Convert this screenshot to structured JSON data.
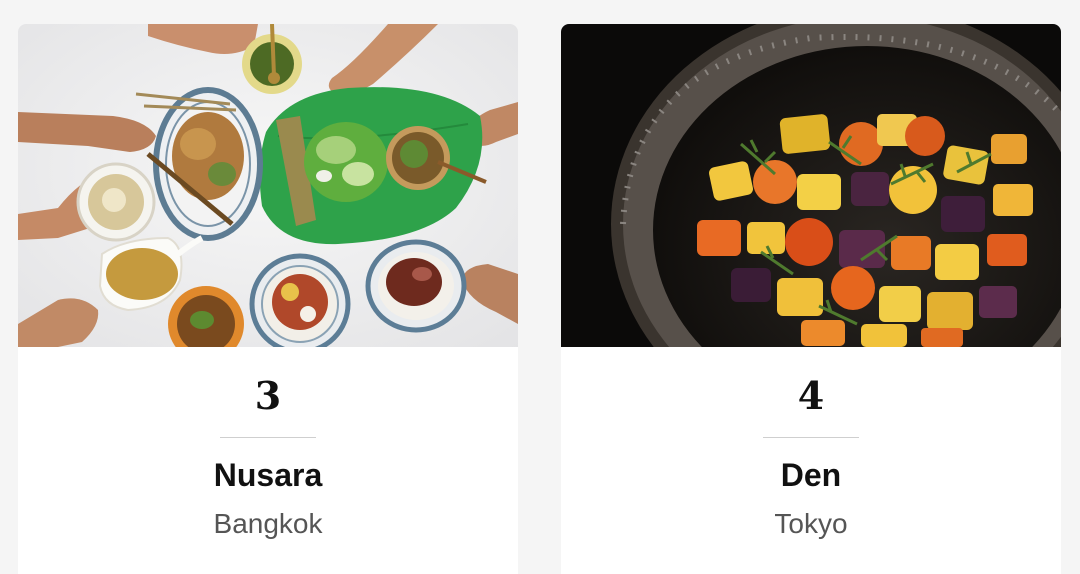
{
  "cards": [
    {
      "rank": "3",
      "name": "Nusara",
      "city": "Bangkok",
      "image_alt": "Overhead view of Thai dishes on a white table with hands reaching in"
    },
    {
      "rank": "4",
      "name": "Den",
      "city": "Tokyo",
      "image_alt": "Close-up of roasted root vegetables in a dark clay pot"
    }
  ],
  "colors": {
    "page_background": "#f5f5f5",
    "card_background": "#ffffff",
    "rank_text": "#111111",
    "name_text": "#111111",
    "city_text": "#555555",
    "divider": "#cfcfcf"
  }
}
